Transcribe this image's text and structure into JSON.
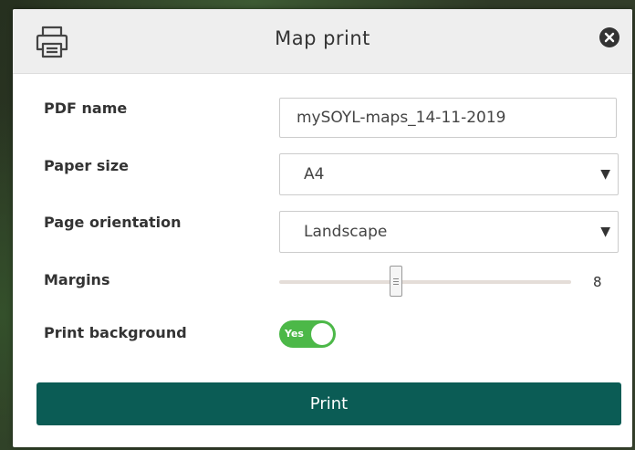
{
  "dialog": {
    "title": "Map print",
    "icons": {
      "header": "printer-icon",
      "close": "close-icon"
    }
  },
  "form": {
    "pdf_name": {
      "label": "PDF name",
      "value": "mySOYL-maps_14-11-2019"
    },
    "paper_size": {
      "label": "Paper size",
      "value": "A4"
    },
    "page_orientation": {
      "label": "Page orientation",
      "value": "Landscape"
    },
    "margins": {
      "label": "Margins",
      "value": 8,
      "display": "8",
      "level_fraction": 0.4
    },
    "print_background": {
      "label": "Print background",
      "toggle_text": "Yes",
      "enabled": true
    }
  },
  "actions": {
    "print_label": "Print"
  },
  "colors": {
    "primary_button": "#0b5c55",
    "toggle_on": "#4cb848",
    "header_bg": "#eeeeee"
  }
}
